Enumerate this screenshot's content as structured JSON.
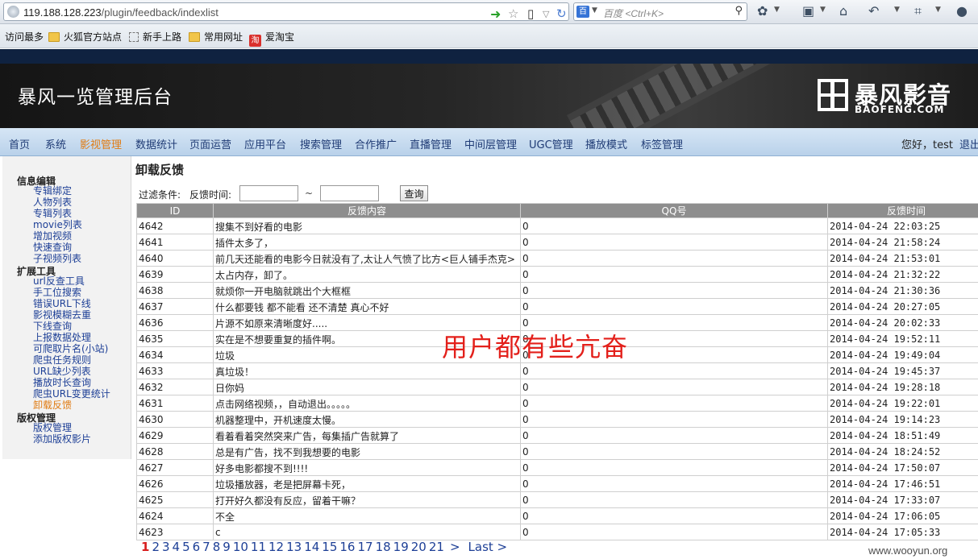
{
  "browser": {
    "url_host": "119.188.128.223",
    "url_path": "/plugin/feedback/indexlist",
    "search_placeholder": "百度 <Ctrl+K>",
    "search_engine_icon": "百"
  },
  "bookmarks": [
    {
      "label": "访问最多",
      "icon": "none"
    },
    {
      "label": "火狐官方站点",
      "icon": "folder"
    },
    {
      "label": "新手上路",
      "icon": "dashed-page"
    },
    {
      "label": "常用网址",
      "icon": "folder"
    },
    {
      "label": "爱淘宝",
      "icon": "taobao",
      "glyph": "淘"
    }
  ],
  "header": {
    "title": "暴风一览管理后台",
    "logo_text": "暴风影音",
    "logo_sub": "BAOFENG.COM"
  },
  "nav": {
    "items": [
      "首页",
      "系统",
      "影视管理",
      "数据统计",
      "页面运营",
      "应用平台",
      "搜索管理",
      "合作推广",
      "直播管理",
      "中间层管理",
      "UGC管理",
      "播放模式",
      "标签管理"
    ],
    "active": "影视管理",
    "greeting": "您好，test",
    "logout": "退出"
  },
  "sidebar": {
    "groups": [
      {
        "title": "信息编辑",
        "links": [
          "专辑绑定",
          "人物列表",
          "专辑列表",
          "movie列表",
          "增加视频",
          "快速查询",
          "子视频列表"
        ]
      },
      {
        "title": "扩展工具",
        "links": [
          "url反查工具",
          "手工位搜索",
          "错误URL下线",
          "影视模糊去重",
          "下线查询",
          "上报数据处理",
          "可爬取片名(小站)",
          "爬虫任务规则",
          "URL缺少列表",
          "播放时长查询",
          "爬虫URL变更统计",
          "卸载反馈"
        ]
      },
      {
        "title": "版权管理",
        "links": [
          "版权管理",
          "添加版权影片"
        ]
      }
    ],
    "active": "卸载反馈"
  },
  "content": {
    "title": "卸载反馈",
    "filter_label": "过滤条件:",
    "time_label": "反馈时间:",
    "date_separator": "~",
    "query_button": "查询",
    "columns": [
      "ID",
      "反馈内容",
      "QQ号",
      "反馈时间"
    ],
    "rows": [
      [
        "4642",
        "搜集不到好看的电影",
        "0",
        "2014-04-24 22:03:25"
      ],
      [
        "4641",
        "插件太多了，",
        "0",
        "2014-04-24 21:58:24"
      ],
      [
        "4640",
        "前几天还能看的电影今日就没有了,太让人气愤了比方<巨人铺手杰克>",
        "0",
        "2014-04-24 21:53:01"
      ],
      [
        "4639",
        "太占内存，卸了。",
        "0",
        "2014-04-24 21:32:22"
      ],
      [
        "4638",
        "就烦你一开电脑就跳出个大框框",
        "0",
        "2014-04-24 21:30:36"
      ],
      [
        "4637",
        "什么都要钱 都不能看 还不清楚 真心不好",
        "0",
        "2014-04-24 20:27:05"
      ],
      [
        "4636",
        "片源不如原来清晰度好.....",
        "0",
        "2014-04-24 20:02:33"
      ],
      [
        "4635",
        "实在是不想要重复的插件啊。",
        "0",
        "2014-04-24 19:52:11"
      ],
      [
        "4634",
        "垃圾",
        "0",
        "2014-04-24 19:49:04"
      ],
      [
        "4633",
        "真垃圾！",
        "0",
        "2014-04-24 19:45:37"
      ],
      [
        "4632",
        "日你妈",
        "0",
        "2014-04-24 19:28:18"
      ],
      [
        "4631",
        "点击网络视频，，自动退出。。。。。",
        "0",
        "2014-04-24 19:22:01"
      ],
      [
        "4630",
        "机器整理中，开机速度太慢。",
        "0",
        "2014-04-24 19:14:23"
      ],
      [
        "4629",
        "看着看着突然突来广告，每集插广告就算了",
        "0",
        "2014-04-24 18:51:49"
      ],
      [
        "4628",
        "总是有广告，找不到我想要的电影",
        "0",
        "2014-04-24 18:24:52"
      ],
      [
        "4627",
        "好多电影都搜不到!!!!",
        "0",
        "2014-04-24 17:50:07"
      ],
      [
        "4626",
        "垃圾播放器，老是把屏幕卡死，",
        "0",
        "2014-04-24 17:46:51"
      ],
      [
        "4625",
        "打开好久都没有反应，留着干嘛？",
        "0",
        "2014-04-24 17:33:07"
      ],
      [
        "4624",
        "不全",
        "0",
        "2014-04-24 17:06:05"
      ],
      [
        "4623",
        "c",
        "0",
        "2014-04-24 17:05:33"
      ]
    ]
  },
  "pagination": {
    "current": "1",
    "pages": [
      "2",
      "3",
      "4",
      "5",
      "6",
      "7",
      "8",
      "9",
      "10",
      "11",
      "12",
      "13",
      "14",
      "15",
      "16",
      "17",
      "18",
      "19",
      "20",
      "21"
    ],
    "next": ">",
    "last": "Last >"
  },
  "overlay_caption": "用户都有些亢奋",
  "watermark": "www.wooyun.org",
  "colors": {
    "nav_active": "#e07b12",
    "link": "#1d3f96",
    "caption_red": "#e3201b",
    "table_header": "#8e8e8e"
  }
}
